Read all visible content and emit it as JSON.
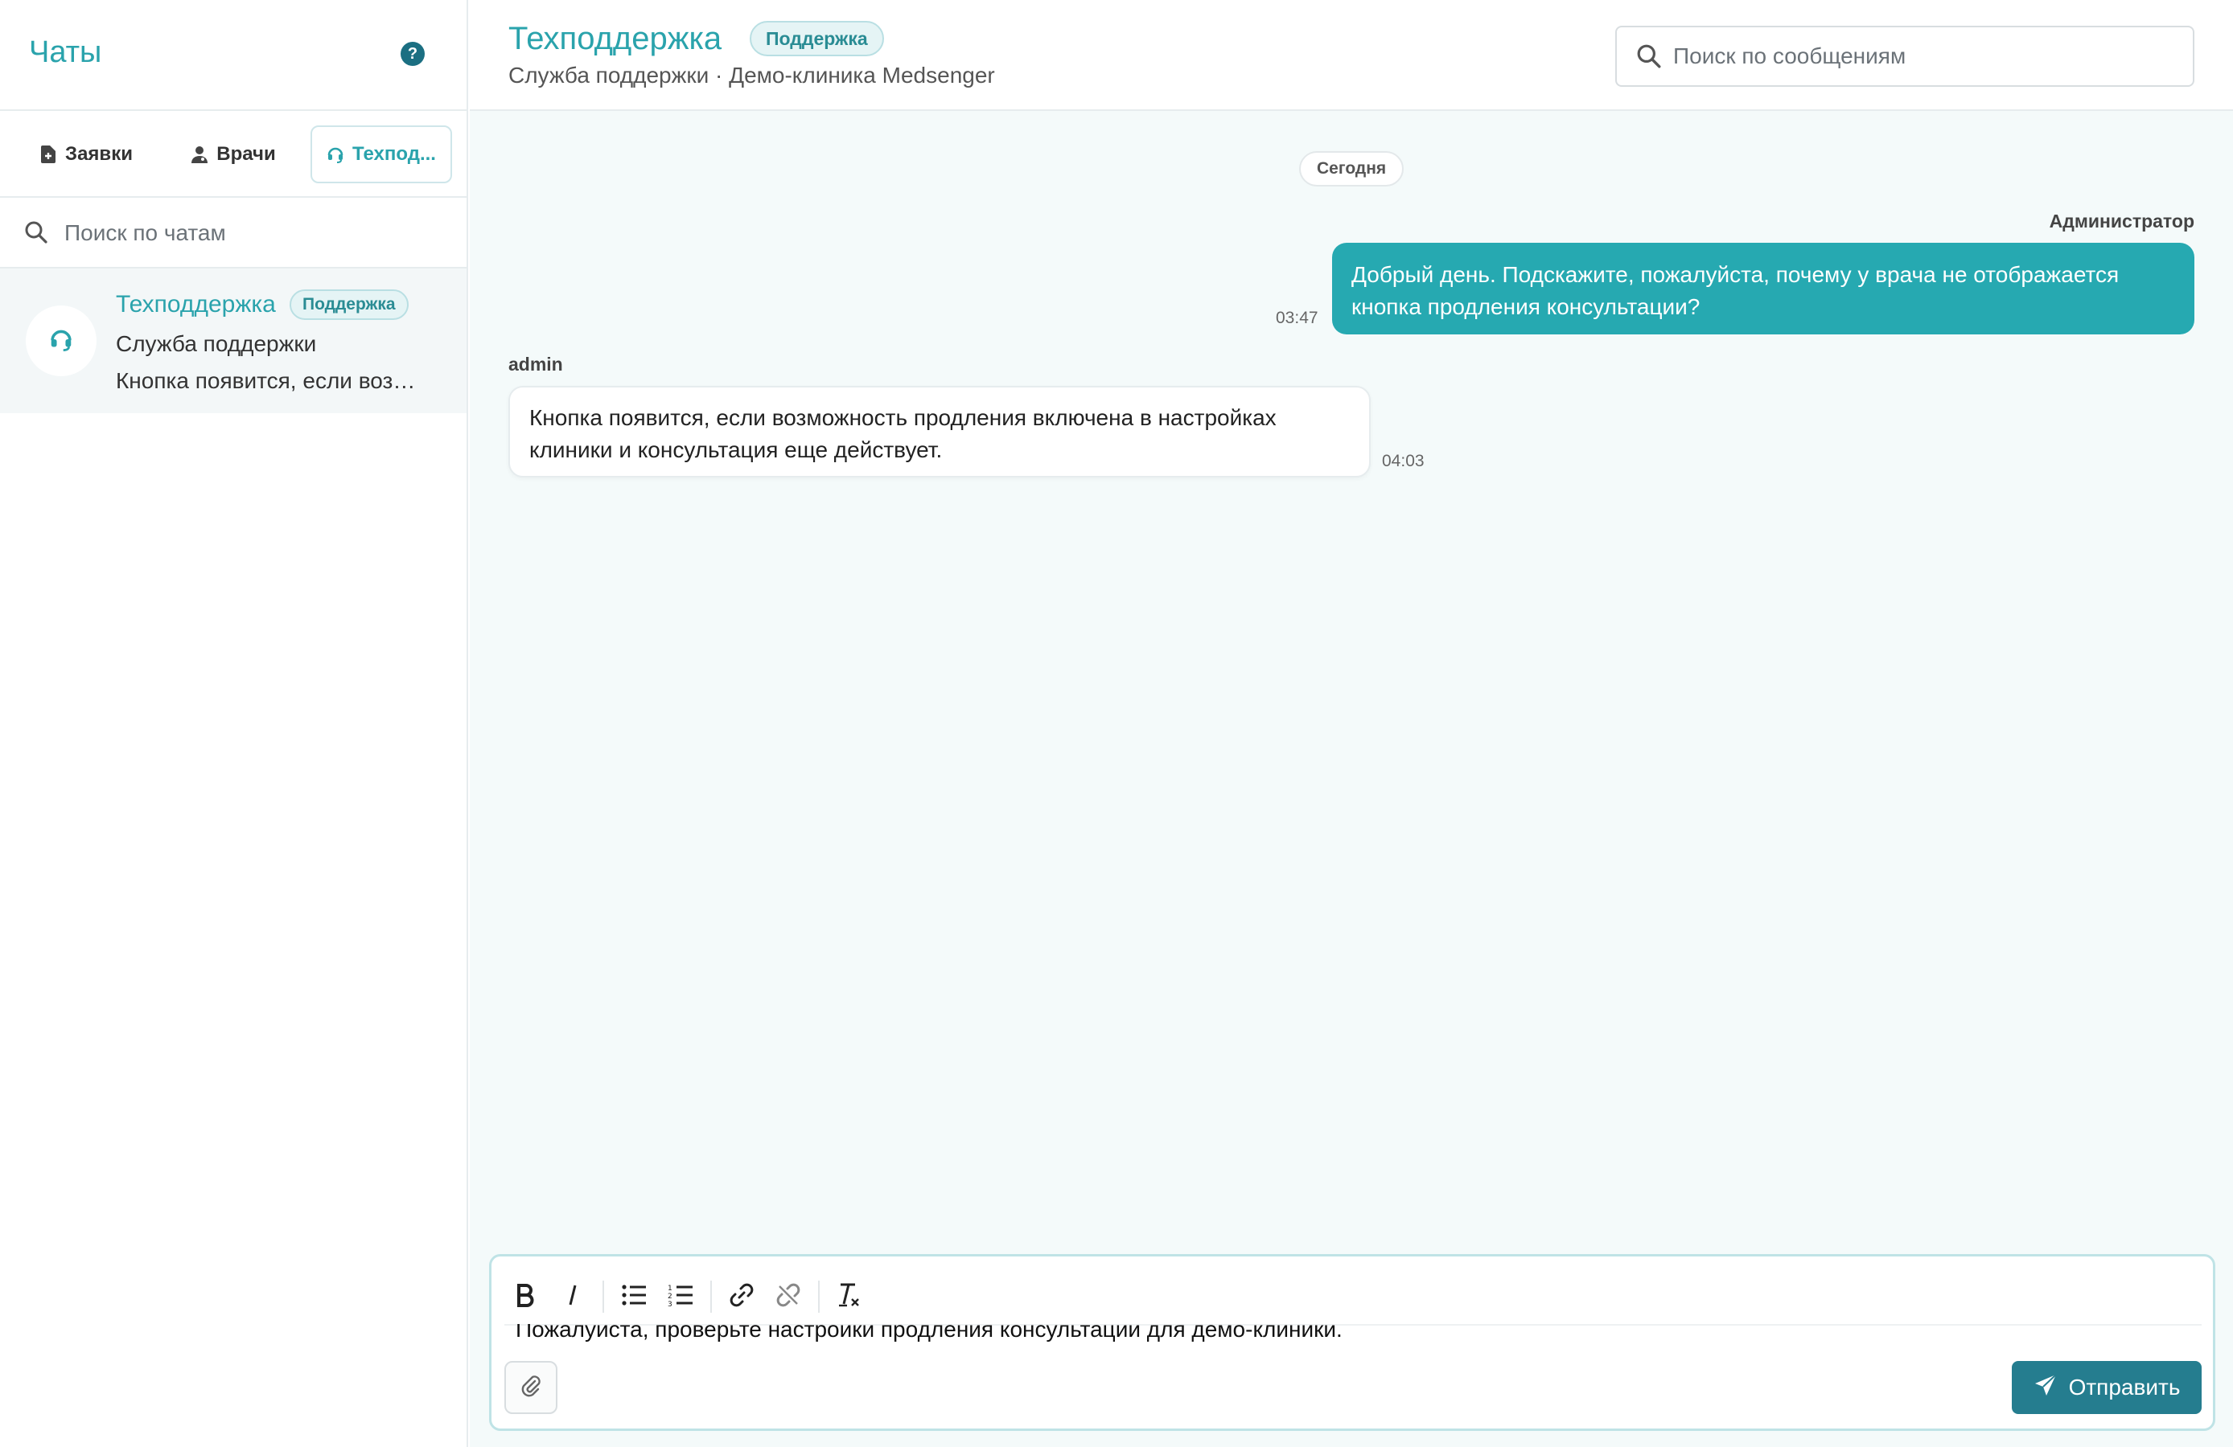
{
  "sidebar": {
    "title": "Чаты",
    "help_icon": "?",
    "tabs": [
      {
        "label": "Заявки",
        "icon": "file-plus-icon"
      },
      {
        "label": "Врачи",
        "icon": "doctor-icon"
      },
      {
        "label": "Техпод...",
        "icon": "headset-icon",
        "active": true
      }
    ],
    "search": {
      "placeholder": "Поиск по чатам"
    },
    "chats": [
      {
        "name": "Техподдержка",
        "badge": "Поддержка",
        "subtitle": "Служба поддержки",
        "preview": "Кнопка появится, если возможность продления включена в настройках клиники и консультация еще действует."
      }
    ]
  },
  "header": {
    "title": "Техподдержка",
    "badge": "Поддержка",
    "subtitle": "Служба поддержки · Демо-клиника Medsenger",
    "search_placeholder": "Поиск по сообщениям"
  },
  "messages": {
    "day_label": "Сегодня",
    "items": [
      {
        "direction": "out",
        "sender": "Администратор",
        "text": "Добрый день. Подскажите, пожалуйста, почему у врача не отображается кнопка продления консультации?",
        "time": "03:47"
      },
      {
        "direction": "in",
        "sender": "admin",
        "text": "Кнопка появится, если возможность продления включена в настройках клиники и консультация еще действует.",
        "time": "04:03"
      }
    ]
  },
  "composer": {
    "text": "Пожалуйста, проверьте настройки продления консультаций для демо-клиники.",
    "send_label": "Отправить",
    "toolbar": [
      "bold",
      "italic",
      "bullet-list",
      "numbered-list",
      "link",
      "unlink",
      "clear-format"
    ]
  },
  "colors": {
    "accent": "#2aa3ac",
    "outgoing_bubble": "#26a9b1",
    "send_button": "#257d8f",
    "help_icon": "#1b6f82"
  }
}
